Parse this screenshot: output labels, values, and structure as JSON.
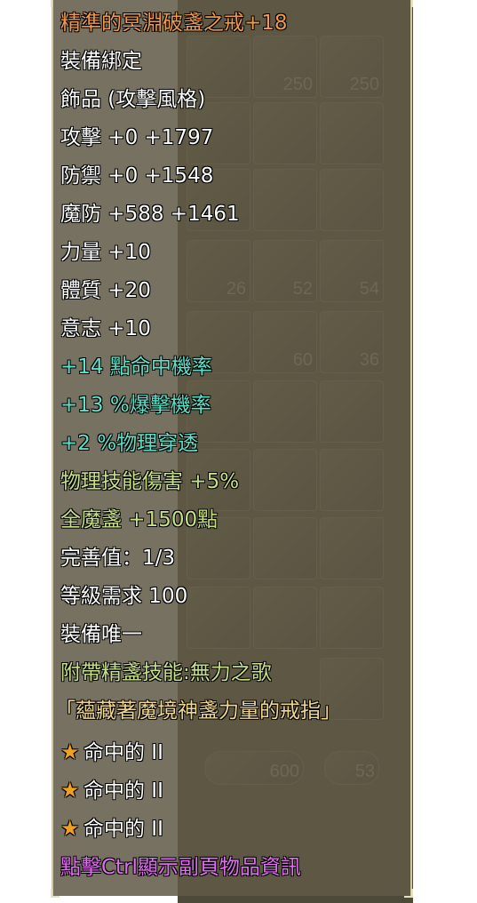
{
  "item": {
    "title": "精準的冥淵破盞之戒+18",
    "lines": [
      "裝備綁定",
      "飾品 (攻擊風格)",
      "攻擊 +0 +1797",
      "防禦 +0 +1548",
      "魔防 +588 +1461",
      "力量 +10",
      "體質 +20",
      "意志 +10"
    ],
    "bonus_cyan": [
      "+14 點命中機率",
      "+13 %爆擊機率",
      "+2 %物理穿透"
    ],
    "bonus_green": [
      "物理技能傷害 +5%",
      "全魔盞 +1500點"
    ],
    "info": [
      "完善值：1/3",
      "等級需求 100",
      "裝備唯一"
    ],
    "skill": "附帶精盞技能:無力之歌",
    "description": "「蘊藏著魔境神盞力量的戒指」",
    "enchant": [
      "命中的 II",
      "命中的 II",
      "命中的 II"
    ],
    "hint": "點擊Ctrl顯示副頁物品資訊"
  },
  "inventory_counts": [
    "250",
    "250",
    "26",
    "52",
    "54",
    "60",
    "36",
    "600",
    "53"
  ],
  "colors": {
    "title": "#f09a4c",
    "white": "#ffffff",
    "cyan": "#5fe0c8",
    "green": "#c8e08a",
    "description": "#f0d890",
    "hint": "#e070f0",
    "star": "#f0a020"
  }
}
